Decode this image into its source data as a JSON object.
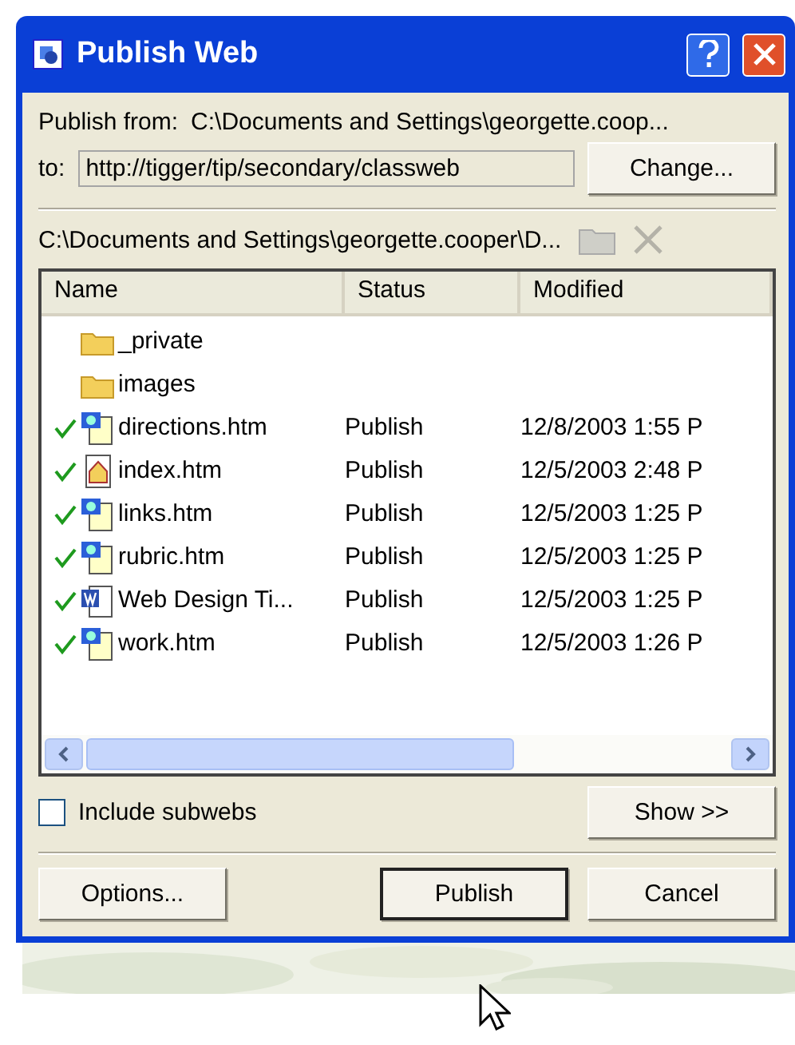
{
  "window": {
    "title": "Publish Web"
  },
  "publish_from": {
    "label": "Publish from:",
    "value": "C:\\Documents and Settings\\georgette.coop..."
  },
  "to": {
    "label": "to:",
    "value": "http://tigger/tip/secondary/classweb",
    "button": "Change..."
  },
  "folder_path": "C:\\Documents and Settings\\georgette.cooper\\D...",
  "list": {
    "columns": [
      "Name",
      "Status",
      "Modified"
    ],
    "rows": [
      {
        "kind": "folder",
        "checked": false,
        "name": "_private"
      },
      {
        "kind": "folder",
        "checked": false,
        "name": "images"
      },
      {
        "kind": "page",
        "checked": true,
        "name": "directions.htm",
        "status": "Publish",
        "modified": "12/8/2003 1:55 P"
      },
      {
        "kind": "home",
        "checked": true,
        "name": "index.htm",
        "status": "Publish",
        "modified": "12/5/2003 2:48 P"
      },
      {
        "kind": "page",
        "checked": true,
        "name": "links.htm",
        "status": "Publish",
        "modified": "12/5/2003 1:25 P"
      },
      {
        "kind": "page",
        "checked": true,
        "name": "rubric.htm",
        "status": "Publish",
        "modified": "12/5/2003 1:25 P"
      },
      {
        "kind": "word",
        "checked": true,
        "name": "Web Design Ti...",
        "status": "Publish",
        "modified": "12/5/2003 1:25 P"
      },
      {
        "kind": "page",
        "checked": true,
        "name": "work.htm",
        "status": "Publish",
        "modified": "12/5/2003 1:26 P"
      }
    ]
  },
  "include_subwebs": {
    "label": "Include subwebs",
    "checked": false
  },
  "show_button": "Show >>",
  "buttons": [
    {
      "label": "Options...",
      "default": false
    },
    {
      "label": "Publish",
      "default": true
    },
    {
      "label": "Cancel",
      "default": false
    }
  ]
}
